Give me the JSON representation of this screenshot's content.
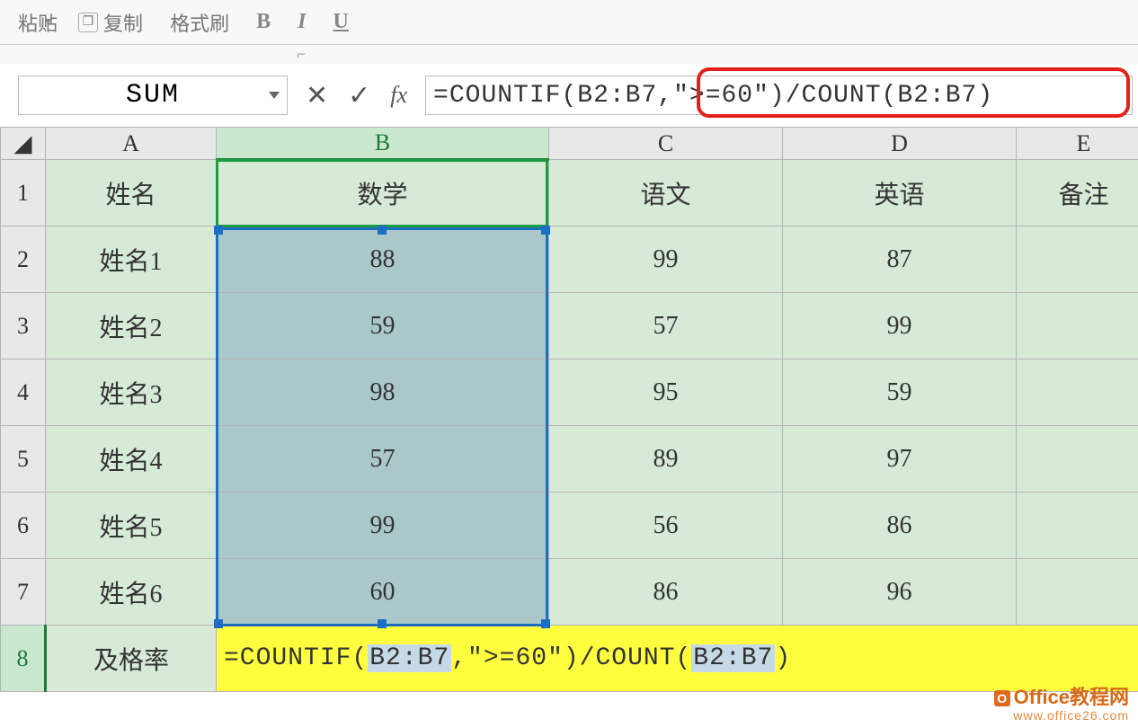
{
  "ribbon": {
    "paste": "粘贴",
    "copy": "复制",
    "format_painter": "格式刷"
  },
  "name_box": "SUM",
  "formula_bar": "=COUNTIF(B2:B7,\">=60\")/COUNT(B2:B7)",
  "columns": [
    "A",
    "B",
    "C",
    "D",
    "E"
  ],
  "row_numbers": [
    "1",
    "2",
    "3",
    "4",
    "5",
    "6",
    "7",
    "8"
  ],
  "headers": {
    "A": "姓名",
    "B": "数学",
    "C": "语文",
    "D": "英语",
    "E": "备注"
  },
  "rows": [
    {
      "A": "姓名1",
      "B": "88",
      "C": "99",
      "D": "87",
      "E": ""
    },
    {
      "A": "姓名2",
      "B": "59",
      "C": "57",
      "D": "99",
      "E": ""
    },
    {
      "A": "姓名3",
      "B": "98",
      "C": "95",
      "D": "59",
      "E": ""
    },
    {
      "A": "姓名4",
      "B": "57",
      "C": "89",
      "D": "97",
      "E": ""
    },
    {
      "A": "姓名5",
      "B": "99",
      "C": "56",
      "D": "86",
      "E": ""
    },
    {
      "A": "姓名6",
      "B": "60",
      "C": "86",
      "D": "96",
      "E": ""
    }
  ],
  "summary_label": "及格率",
  "cell_formula_parts": {
    "p1": "=COUNTIF(",
    "r1": "B2:B7",
    "p2": ",\">=60\")/COUNT(",
    "r2": "B2:B7",
    "p3": ")"
  },
  "watermark": {
    "line1": "Office教程网",
    "line2": "www.office26.com"
  }
}
